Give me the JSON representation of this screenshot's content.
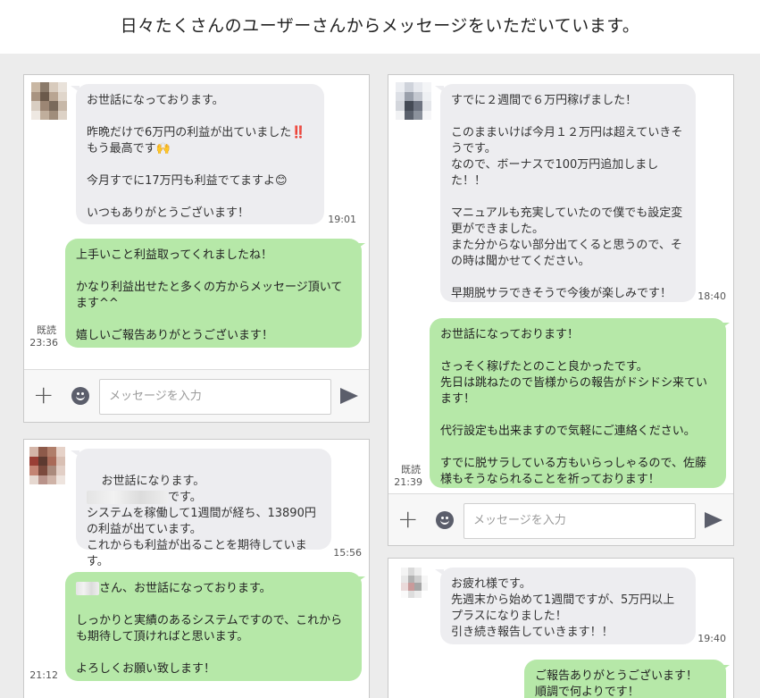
{
  "heading": "日々たくさんのユーザーさんからメッセージをいただいています。",
  "input_placeholder": "メッセージを入力",
  "panels": [
    {
      "incoming": "お世話になっております。\n\n昨晩だけで6万円の利益が出ていました‼️\nもう最高です🙌\n\n今月すでに17万円も利益でてますよ😊\n\nいつもありがとうございます！",
      "incoming_time": "19:01",
      "outgoing": "上手いこと利益取ってくれましたね！\n\nかなり利益出せたと多くの方からメッセージ頂いてます^^\n\n嬉しいご報告ありがとうございます！",
      "read": "既読",
      "outgoing_time": "23:36"
    },
    {
      "incoming_pre": "お世話になります。",
      "incoming_post": "です。\nシステムを稼働して1週間が経ち、13890円の利益が出ています。\nこれからも利益が出ることを期待しています。",
      "incoming_time": "15:56",
      "outgoing_post": "さん、お世話になっております。\n\nしっかりと実績のあるシステムですので、これからも期待して頂ければと思います。\n\nよろしくお願い致します！",
      "outgoing_time": "21:12"
    },
    {
      "incoming": "すでに２週間で６万円稼げました！\n\nこのままいけば今月１２万円は超えていきそうです。\nなので、ボーナスで100万円追加しました！！\n\nマニュアルも充実していたので僕でも設定変更ができました。\nまた分からない部分出てくると思うので、その時は聞かせてください。\n\n早期脱サラできそうで今後が楽しみです！",
      "incoming_time": "18:40",
      "outgoing": "お世話になっております！\n\nさっそく稼げたとのこと良かったです。\n先日は跳ねたので皆様からの報告がドシドシ来ています！\n\n代行設定も出来ますので気軽にご連絡ください。\n\nすでに脱サラしている方もいらっしゃるので、佐藤様もそうなられることを祈っております！",
      "read": "既読",
      "outgoing_time": "21:39"
    },
    {
      "incoming": "お疲れ様です。\n先週末から始めて1週間ですが、5万円以上プラスになりました！\n引き続き報告していきます！！",
      "incoming_time": "19:40",
      "outgoing": "ご報告ありがとうございます！\n順調で何よりです！"
    }
  ],
  "colors": {
    "incoming_bubble": "#ededf0",
    "outgoing_bubble": "#b6e8a8",
    "page_bg": "#ececec"
  },
  "icons": [
    "plus-icon",
    "emoji-icon",
    "send-icon"
  ]
}
